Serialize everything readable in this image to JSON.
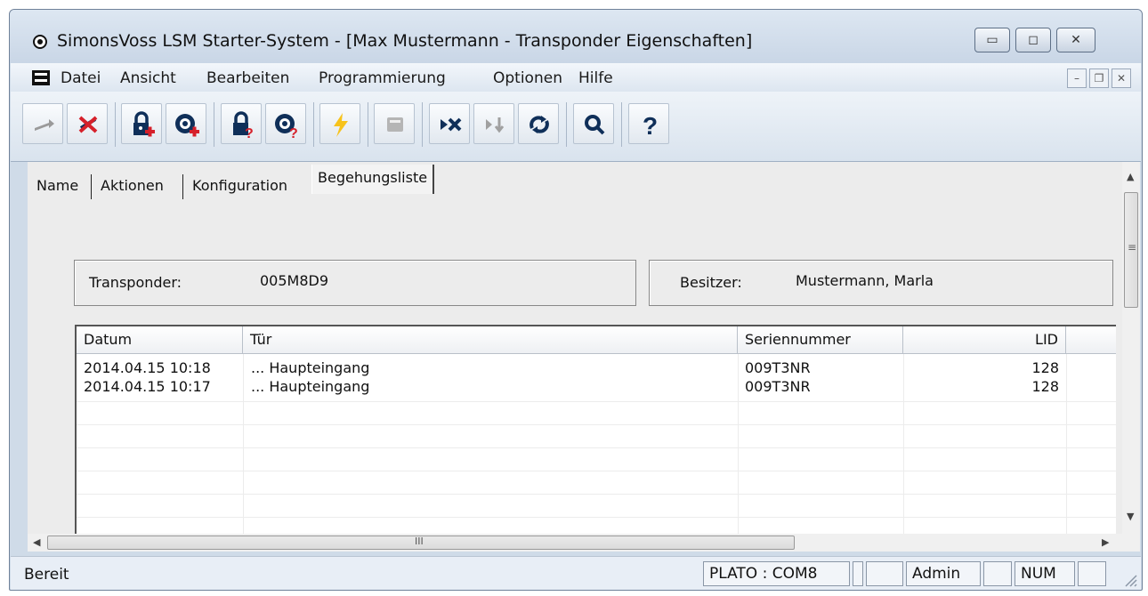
{
  "window": {
    "title": "SimonsVoss LSM Starter-System - [Max Mustermann - Transponder Eigenschaften]",
    "controls": {
      "minimize": "▭",
      "maximize": "◻",
      "close": "✕"
    }
  },
  "menu": {
    "items": [
      "Datei",
      "Ansicht",
      "Bearbeiten",
      "Programmierung",
      "Optionen",
      "Hilfe"
    ],
    "mdi_controls": {
      "minimize": "–",
      "restore": "❐",
      "close": "✕"
    }
  },
  "toolbar": {
    "buttons": [
      {
        "icon": "back-arrow-icon",
        "enabled": false
      },
      {
        "icon": "delete-x-icon",
        "enabled": true
      },
      {
        "icon": "add-lock-icon",
        "enabled": true
      },
      {
        "icon": "add-transponder-icon",
        "enabled": true
      },
      {
        "icon": "lock-question-icon",
        "enabled": true
      },
      {
        "icon": "transponder-question-icon",
        "enabled": true
      },
      {
        "icon": "lightning-icon",
        "enabled": true
      },
      {
        "icon": "print-icon",
        "enabled": false
      },
      {
        "icon": "skip-delete-icon",
        "enabled": true
      },
      {
        "icon": "skip-down-icon",
        "enabled": false
      },
      {
        "icon": "sync-icon",
        "enabled": true
      },
      {
        "icon": "search-icon",
        "enabled": true
      },
      {
        "icon": "help-icon",
        "enabled": true
      }
    ],
    "colors": {
      "red": "#d6202a",
      "blue_dark": "#0f2f59",
      "yellow": "#f7c31c"
    }
  },
  "tabs": [
    "Name",
    "Aktionen",
    "Konfiguration",
    "Begehungsliste"
  ],
  "active_tab": "Begehungsliste",
  "fields": {
    "transponder_label": "Transponder:",
    "transponder_value": "005M8D9",
    "owner_label": "Besitzer:",
    "owner_value": "Mustermann, Marla"
  },
  "list": {
    "columns": [
      "Datum",
      "Tür",
      "Seriennummer",
      "LID"
    ],
    "rows": [
      {
        "datum": "2014.04.15 10:18",
        "tuer": "... Haupteingang",
        "seriennummer": "009T3NR",
        "lid": "128"
      },
      {
        "datum": "2014.04.15 10:17",
        "tuer": "... Haupteingang",
        "seriennummer": "009T3NR",
        "lid": "128"
      }
    ]
  },
  "scroll": {
    "h_thumb_label": "III",
    "v_thumb_label": "≡"
  },
  "status": {
    "text": "Bereit",
    "panes": [
      "PLATO : COM8",
      "",
      "",
      "Admin",
      "",
      "NUM",
      ""
    ]
  }
}
